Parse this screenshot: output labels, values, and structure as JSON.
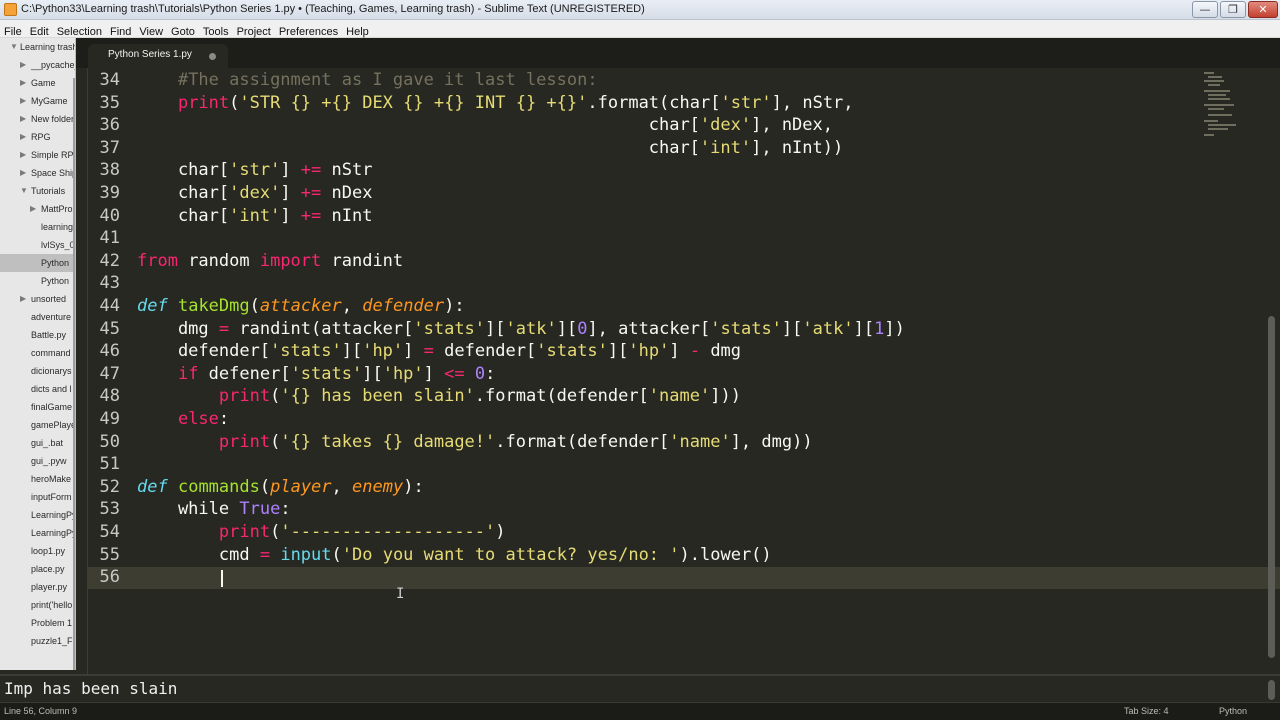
{
  "window": {
    "title": "C:\\Python33\\Learning trash\\Tutorials\\Python Series 1.py • (Teaching, Games, Learning trash) - Sublime Text (UNREGISTERED)",
    "minimize_glyph": "—",
    "maximize_glyph": "❐",
    "close_glyph": "✕"
  },
  "menu": [
    "File",
    "Edit",
    "Selection",
    "Find",
    "View",
    "Goto",
    "Tools",
    "Project",
    "Preferences",
    "Help"
  ],
  "sidebar": {
    "items": [
      {
        "label": "Learning trash",
        "arrow": "▼"
      },
      {
        "label": "__pycache__",
        "arrow": "▶"
      },
      {
        "label": "Game",
        "arrow": "▶"
      },
      {
        "label": "MyGame",
        "arrow": "▶"
      },
      {
        "label": "New folder",
        "arrow": "▶"
      },
      {
        "label": "RPG",
        "arrow": "▶"
      },
      {
        "label": "Simple RPG",
        "arrow": "▶"
      },
      {
        "label": "Space Ship",
        "arrow": "▶"
      },
      {
        "label": "Tutorials",
        "arrow": "▼"
      },
      {
        "label": "MattPro",
        "arrow": "▶"
      },
      {
        "label": "learning",
        "arrow": ""
      },
      {
        "label": "lvlSys_0",
        "arrow": ""
      },
      {
        "label": "Python",
        "arrow": ""
      },
      {
        "label": "Python",
        "arrow": ""
      },
      {
        "label": "unsorted",
        "arrow": "▶"
      },
      {
        "label": "adventure",
        "arrow": ""
      },
      {
        "label": "Battle.py",
        "arrow": ""
      },
      {
        "label": "command",
        "arrow": ""
      },
      {
        "label": "dicionarys",
        "arrow": ""
      },
      {
        "label": "dicts and l",
        "arrow": ""
      },
      {
        "label": "finalGame",
        "arrow": ""
      },
      {
        "label": "gamePlaye",
        "arrow": ""
      },
      {
        "label": "gui_.bat",
        "arrow": ""
      },
      {
        "label": "gui_.pyw",
        "arrow": ""
      },
      {
        "label": "heroMake",
        "arrow": ""
      },
      {
        "label": "inputForm",
        "arrow": ""
      },
      {
        "label": "LearningPy",
        "arrow": ""
      },
      {
        "label": "LearningPy",
        "arrow": ""
      },
      {
        "label": "loop1.py",
        "arrow": ""
      },
      {
        "label": "place.py",
        "arrow": ""
      },
      {
        "label": "player.py",
        "arrow": ""
      },
      {
        "label": "print('hello",
        "arrow": ""
      },
      {
        "label": "Problem 1",
        "arrow": ""
      },
      {
        "label": "puzzle1_Fi",
        "arrow": ""
      }
    ]
  },
  "tab": {
    "label": "Python Series 1.py"
  },
  "editor": {
    "lines": [
      {
        "n": "34",
        "tokens": [
          [
            "    ",
            ""
          ],
          [
            "#The assignment as I gave it last lesson:",
            "c-cmt"
          ]
        ]
      },
      {
        "n": "35",
        "tokens": [
          [
            "    ",
            ""
          ],
          [
            "print",
            "c-kw"
          ],
          [
            "(",
            ""
          ],
          [
            "'STR {} +{} DEX {} +{} INT {} +{}'",
            "c-str"
          ],
          [
            ".format(char[",
            ""
          ],
          [
            "'str'",
            "c-str"
          ],
          [
            "], nStr,",
            ""
          ]
        ]
      },
      {
        "n": "36",
        "tokens": [
          [
            "                                                  char[",
            ""
          ],
          [
            "'dex'",
            "c-str"
          ],
          [
            "], nDex,",
            ""
          ]
        ]
      },
      {
        "n": "37",
        "tokens": [
          [
            "                                                  char[",
            ""
          ],
          [
            "'int'",
            "c-str"
          ],
          [
            "], nInt))",
            ""
          ]
        ]
      },
      {
        "n": "38",
        "tokens": [
          [
            "    char[",
            ""
          ],
          [
            "'str'",
            "c-str"
          ],
          [
            "] ",
            ""
          ],
          [
            "+=",
            "c-kw"
          ],
          [
            " nStr",
            ""
          ]
        ]
      },
      {
        "n": "39",
        "tokens": [
          [
            "    char[",
            ""
          ],
          [
            "'dex'",
            "c-str"
          ],
          [
            "] ",
            ""
          ],
          [
            "+=",
            "c-kw"
          ],
          [
            " nDex",
            ""
          ]
        ]
      },
      {
        "n": "40",
        "tokens": [
          [
            "    char[",
            ""
          ],
          [
            "'int'",
            "c-str"
          ],
          [
            "] ",
            ""
          ],
          [
            "+=",
            "c-kw"
          ],
          [
            " nInt",
            ""
          ]
        ]
      },
      {
        "n": "41",
        "tokens": []
      },
      {
        "n": "42",
        "tokens": [
          [
            "from",
            "c-kw"
          ],
          [
            " random ",
            ""
          ],
          [
            "import",
            "c-kw"
          ],
          [
            " randint",
            ""
          ]
        ]
      },
      {
        "n": "43",
        "tokens": []
      },
      {
        "n": "44",
        "tokens": [
          [
            "def",
            "c-def"
          ],
          [
            " ",
            ""
          ],
          [
            "takeDmg",
            "c-fn"
          ],
          [
            "(",
            ""
          ],
          [
            "attacker",
            "c-param"
          ],
          [
            ", ",
            ""
          ],
          [
            "defender",
            "c-param"
          ],
          [
            "):",
            ""
          ]
        ]
      },
      {
        "n": "45",
        "tokens": [
          [
            "    dmg ",
            ""
          ],
          [
            "=",
            "c-kw"
          ],
          [
            " randint(attacker[",
            ""
          ],
          [
            "'stats'",
            "c-str"
          ],
          [
            "][",
            ""
          ],
          [
            "'atk'",
            "c-str"
          ],
          [
            "][",
            ""
          ],
          [
            "0",
            "c-num"
          ],
          [
            "], attacker[",
            ""
          ],
          [
            "'stats'",
            "c-str"
          ],
          [
            "][",
            ""
          ],
          [
            "'atk'",
            "c-str"
          ],
          [
            "][",
            ""
          ],
          [
            "1",
            "c-num"
          ],
          [
            "])",
            ""
          ]
        ]
      },
      {
        "n": "46",
        "tokens": [
          [
            "    defender[",
            ""
          ],
          [
            "'stats'",
            "c-str"
          ],
          [
            "][",
            ""
          ],
          [
            "'hp'",
            "c-str"
          ],
          [
            "] ",
            ""
          ],
          [
            "=",
            "c-kw"
          ],
          [
            " defender[",
            ""
          ],
          [
            "'stats'",
            "c-str"
          ],
          [
            "][",
            ""
          ],
          [
            "'hp'",
            "c-str"
          ],
          [
            "] ",
            ""
          ],
          [
            "-",
            "c-kw"
          ],
          [
            " dmg",
            ""
          ]
        ]
      },
      {
        "n": "47",
        "tokens": [
          [
            "    ",
            ""
          ],
          [
            "if",
            "c-kw"
          ],
          [
            " defener[",
            ""
          ],
          [
            "'stats'",
            "c-str"
          ],
          [
            "][",
            ""
          ],
          [
            "'hp'",
            "c-str"
          ],
          [
            "] ",
            ""
          ],
          [
            "<=",
            "c-kw"
          ],
          [
            " ",
            ""
          ],
          [
            "0",
            "c-num"
          ],
          [
            ":",
            ""
          ]
        ]
      },
      {
        "n": "48",
        "tokens": [
          [
            "        ",
            ""
          ],
          [
            "print",
            "c-kw"
          ],
          [
            "(",
            ""
          ],
          [
            "'{} has been slain'",
            "c-str"
          ],
          [
            ".format(defender[",
            ""
          ],
          [
            "'name'",
            "c-str"
          ],
          [
            "]))",
            ""
          ]
        ]
      },
      {
        "n": "49",
        "tokens": [
          [
            "    ",
            ""
          ],
          [
            "else",
            "c-kw"
          ],
          [
            ":",
            ""
          ]
        ]
      },
      {
        "n": "50",
        "tokens": [
          [
            "        ",
            ""
          ],
          [
            "print",
            "c-kw"
          ],
          [
            "(",
            ""
          ],
          [
            "'{} takes {} damage!'",
            "c-str"
          ],
          [
            ".format(defender[",
            ""
          ],
          [
            "'name'",
            "c-str"
          ],
          [
            "], dmg))",
            ""
          ]
        ]
      },
      {
        "n": "51",
        "tokens": []
      },
      {
        "n": "52",
        "tokens": [
          [
            "def",
            "c-def"
          ],
          [
            " ",
            ""
          ],
          [
            "commands",
            "c-fn"
          ],
          [
            "(",
            ""
          ],
          [
            "player",
            "c-param"
          ],
          [
            ", ",
            ""
          ],
          [
            "enemy",
            "c-param"
          ],
          [
            "):",
            ""
          ]
        ]
      },
      {
        "n": "53",
        "tokens": [
          [
            "    while ",
            ""
          ],
          [
            "True",
            "c-const"
          ],
          [
            ":",
            ""
          ]
        ]
      },
      {
        "n": "54",
        "tokens": [
          [
            "        ",
            ""
          ],
          [
            "print",
            "c-kw"
          ],
          [
            "(",
            ""
          ],
          [
            "'-------------------'",
            "c-str"
          ],
          [
            ")",
            ""
          ]
        ]
      },
      {
        "n": "55",
        "tokens": [
          [
            "        cmd ",
            ""
          ],
          [
            "=",
            "c-kw"
          ],
          [
            " ",
            ""
          ],
          [
            "input",
            "c-bi"
          ],
          [
            "(",
            ""
          ],
          [
            "'Do you want to attack? yes/no: '",
            "c-str"
          ],
          [
            ").lower()",
            ""
          ]
        ]
      },
      {
        "n": "56",
        "tokens": []
      }
    ]
  },
  "console": {
    "output": "Imp has been slain"
  },
  "status": {
    "position": "Line 56, Column 9",
    "tab_size": "Tab Size: 4",
    "syntax": "Python"
  },
  "colors": {
    "background": "#272822",
    "keyword": "#f92672",
    "string": "#e6db74",
    "function": "#a6e22e",
    "parameter": "#fd971f",
    "number": "#ae81ff",
    "comment": "#75715e",
    "builtin": "#66d9ef"
  }
}
